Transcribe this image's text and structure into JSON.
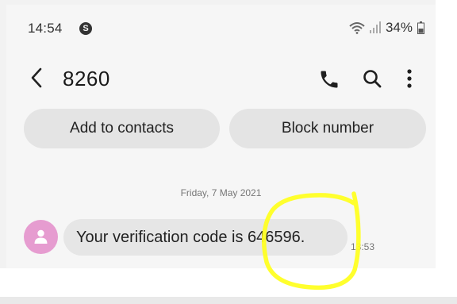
{
  "status_bar": {
    "time": "14:54",
    "battery_percent": "34%",
    "app_notification_icon": "s-circle-icon",
    "wifi_icon": "wifi-icon",
    "signal_icon": "signal-icon",
    "battery_icon": "battery-icon"
  },
  "header": {
    "title": "8260",
    "back_icon": "chevron-left-icon",
    "call_icon": "phone-icon",
    "search_icon": "search-icon",
    "more_icon": "more-vertical-icon"
  },
  "actions": {
    "add_label": "Add to contacts",
    "block_label": "Block number"
  },
  "conversation": {
    "date": "Friday, 7 May 2021",
    "messages": [
      {
        "text": "Your verification code is 646596.",
        "time": "13:53",
        "avatar_color": "#e69cd0"
      }
    ]
  },
  "annotation": {
    "color": "#ffff22"
  }
}
